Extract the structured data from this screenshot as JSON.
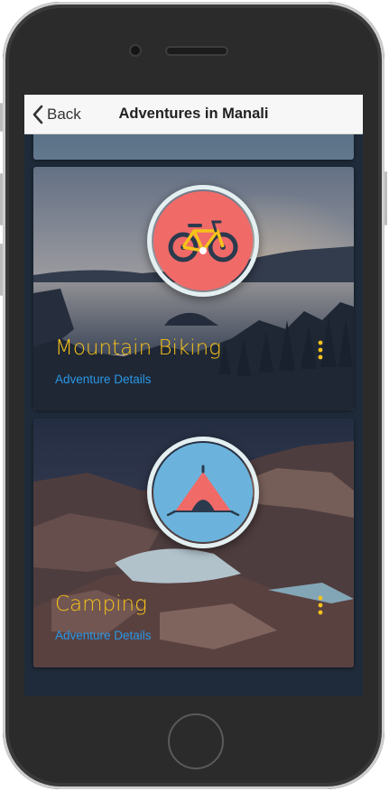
{
  "navbar": {
    "back_label": "Back",
    "title": "Adventures in Manali"
  },
  "adventures": [
    {
      "title": "Mountain Biking",
      "link_label": "Adventure Details",
      "icon": "bicycle-icon",
      "icon_bg": "#f06a68"
    },
    {
      "title": "Camping",
      "link_label": "Adventure Details",
      "icon": "tent-icon",
      "icon_bg": "#6bb3dc"
    }
  ],
  "colors": {
    "title": "#f5c21a",
    "link": "#2a97e6",
    "more": "#f5c21a"
  }
}
